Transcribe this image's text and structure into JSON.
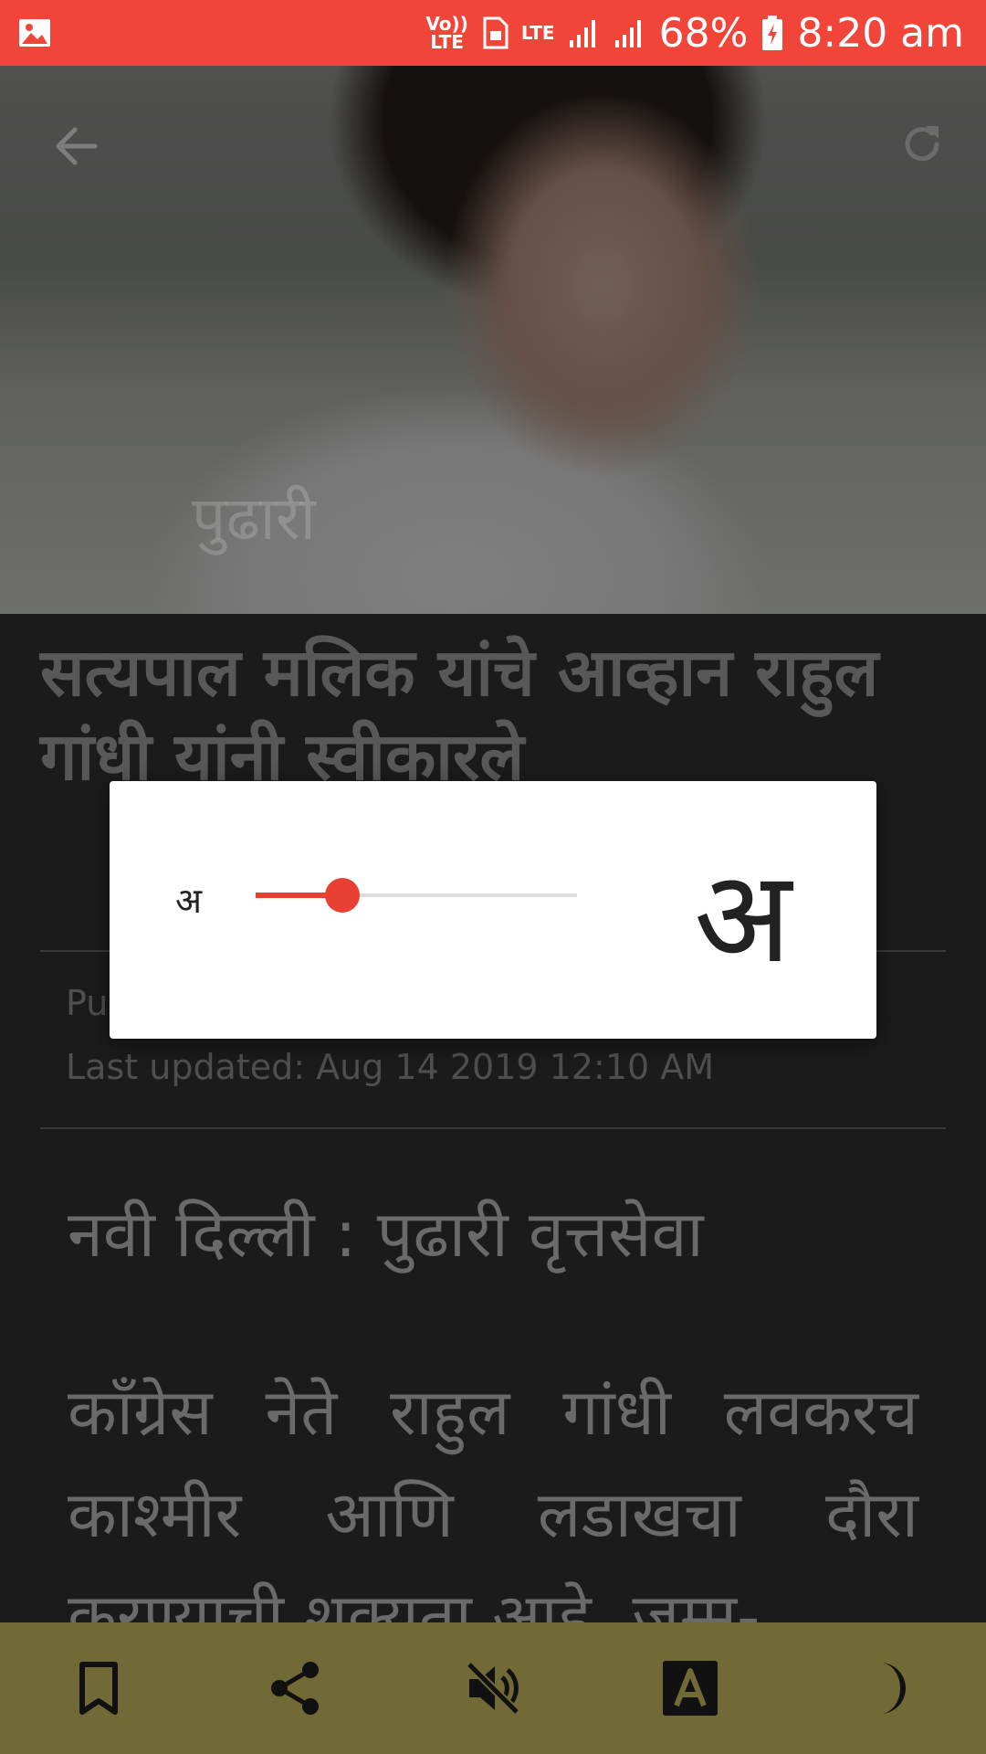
{
  "status_bar": {
    "volte": "Vo)) LTE",
    "lte": "LTE",
    "battery": "68%",
    "time": "8:20 am",
    "background": "#f2453a"
  },
  "hero": {
    "watermark": "पुढारी"
  },
  "article": {
    "headline": "सत्यपाल मलिक यांचे आव्हान राहुल गांधी यांनी स्वीकारले",
    "published_partial": "Pu",
    "last_updated": "Last updated: Aug 14 2019  12:10 AM",
    "dateline": "नवी दिल्ली : पुढारी वृत्तसेवा",
    "body": "काँग्रेस नेते राहुल गांधी लवकरच काश्मीर आणि लडाखचा दौरा करण्याची शक्यता आहे. जम्मू-"
  },
  "font_size_dialog": {
    "small_label": "अ",
    "large_label": "अ",
    "slider_fraction": 0.27,
    "accent": "#ea4034"
  },
  "bottom_bar": {
    "background": "#716a36",
    "icons": [
      "bookmark-icon",
      "share-icon",
      "mute-icon",
      "font-size-icon",
      "night-mode-icon"
    ]
  }
}
